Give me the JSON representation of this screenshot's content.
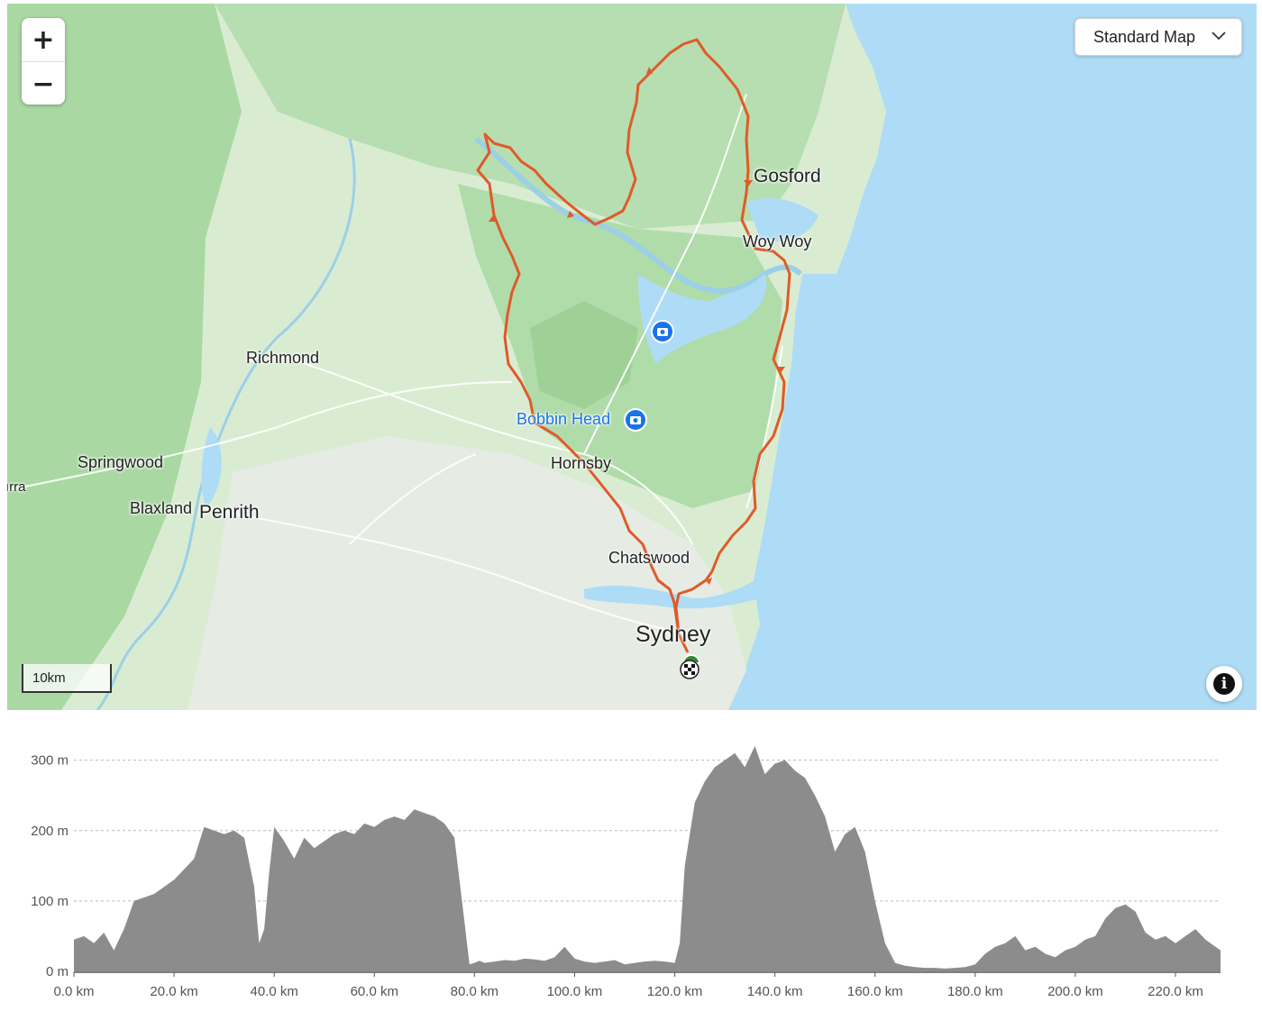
{
  "map": {
    "colors": {
      "land": "#d9ecd2",
      "forest": "#a9d8a3",
      "water": "#aedcf6",
      "route": "#e05a28"
    },
    "zoom": {
      "in_label": "+",
      "out_label": "−"
    },
    "map_type": {
      "selected": "Standard Map",
      "icon": "chevron-down-icon"
    },
    "scale_label": "10km",
    "info_icon": "info-icon",
    "places": {
      "gosford": "Gosford",
      "woy_woy": "Woy Woy",
      "richmond": "Richmond",
      "bobbin_head": "Bobbin Head",
      "hornsby": "Hornsby",
      "springwood": "Springwood",
      "blaxland": "Blaxland",
      "penrith": "Penrith",
      "chatswood": "Chatswood",
      "sydney": "Sydney",
      "edge_fragment": "ırra"
    },
    "markers": {
      "camera": "camera-icon",
      "start": "start-marker-icon",
      "finish": "finish-flag-icon"
    }
  },
  "chart_data": {
    "type": "area",
    "xlabel": "",
    "ylabel": "",
    "xlim": [
      0,
      229
    ],
    "ylim": [
      0,
      320
    ],
    "grid": true,
    "x_ticks": [
      "0.0 km",
      "20.0 km",
      "40.0 km",
      "60.0 km",
      "80.0 km",
      "100.0 km",
      "120.0 km",
      "140.0 km",
      "160.0 km",
      "180.0 km",
      "200.0 km",
      "220.0 km"
    ],
    "y_ticks": [
      "0 m",
      "100 m",
      "200 m",
      "300 m"
    ],
    "series": [
      {
        "distance_km": [
          0,
          2,
          4,
          6,
          8,
          10,
          12,
          14,
          16,
          18,
          20,
          22,
          24,
          26,
          28,
          30,
          32,
          34,
          36,
          37,
          38,
          39,
          40,
          42,
          44,
          46,
          48,
          50,
          52,
          54,
          56,
          58,
          60,
          62,
          64,
          66,
          68,
          70,
          72,
          74,
          76,
          78,
          79,
          80,
          81,
          82,
          84,
          86,
          88,
          90,
          92,
          94,
          96,
          98,
          100,
          102,
          104,
          106,
          108,
          110,
          112,
          114,
          116,
          118,
          120,
          121,
          122,
          124,
          126,
          128,
          130,
          132,
          134,
          136,
          138,
          140,
          142,
          144,
          146,
          148,
          150,
          152,
          154,
          156,
          158,
          160,
          162,
          164,
          165,
          166,
          168,
          170,
          172,
          174,
          176,
          178,
          180,
          182,
          184,
          186,
          188,
          190,
          192,
          194,
          196,
          198,
          200,
          202,
          204,
          206,
          208,
          210,
          212,
          214,
          216,
          218,
          220,
          222,
          224,
          226,
          228,
          229
        ],
        "elevation_m": [
          45,
          50,
          40,
          55,
          30,
          60,
          100,
          105,
          110,
          120,
          130,
          145,
          160,
          205,
          200,
          195,
          200,
          190,
          120,
          40,
          60,
          140,
          205,
          185,
          160,
          190,
          175,
          185,
          195,
          200,
          195,
          210,
          205,
          215,
          220,
          215,
          230,
          225,
          220,
          210,
          190,
          70,
          10,
          12,
          15,
          12,
          14,
          16,
          15,
          18,
          17,
          15,
          20,
          35,
          18,
          14,
          12,
          14,
          16,
          10,
          12,
          14,
          15,
          14,
          12,
          40,
          150,
          240,
          270,
          290,
          300,
          310,
          290,
          320,
          280,
          295,
          300,
          285,
          275,
          250,
          220,
          170,
          195,
          205,
          170,
          100,
          40,
          12,
          10,
          8,
          6,
          5,
          5,
          4,
          5,
          6,
          10,
          25,
          35,
          40,
          50,
          30,
          35,
          25,
          20,
          30,
          35,
          45,
          50,
          75,
          90,
          95,
          85,
          55,
          45,
          50,
          40,
          50,
          60,
          45,
          35,
          30
        ]
      }
    ]
  }
}
